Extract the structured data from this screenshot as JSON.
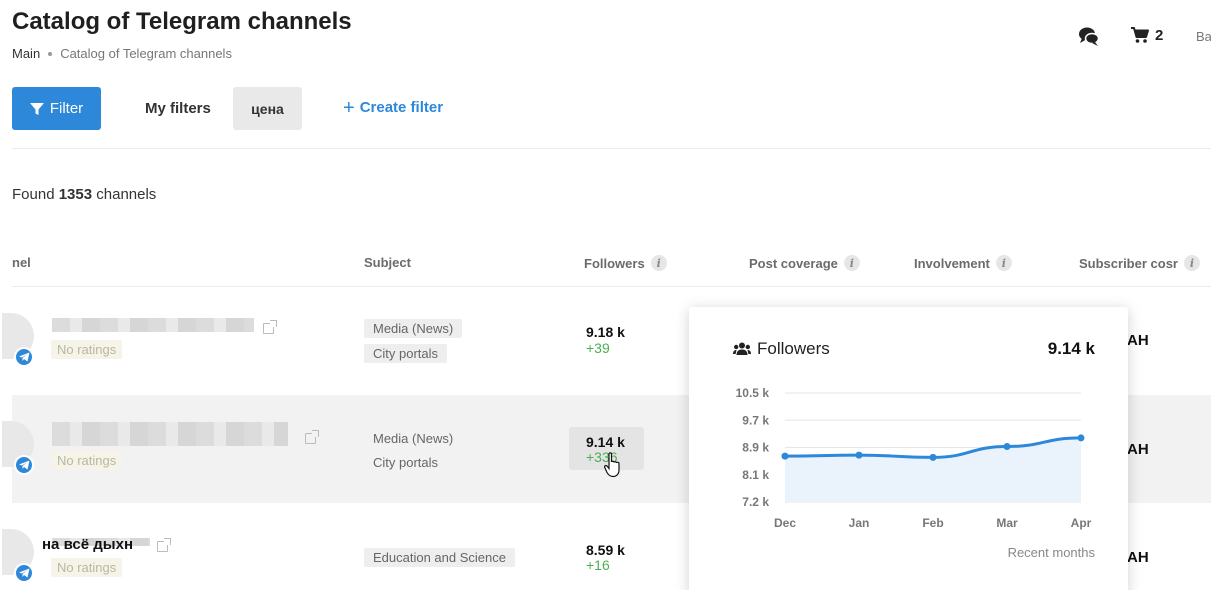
{
  "header": {
    "title": "Catalog of Telegram channels",
    "breadcrumb": {
      "home": "Main",
      "current": "Catalog of Telegram channels"
    },
    "cart_count": "2",
    "lang_partial": "Ba"
  },
  "toolbar": {
    "filter_label": "Filter",
    "my_filters_label": "My filters",
    "saved_filter": "цена",
    "create_filter_label": "Create filter"
  },
  "results": {
    "prefix": "Found",
    "count": "1353",
    "suffix": "channels"
  },
  "columns": [
    {
      "label": "nel"
    },
    {
      "label": "Subject"
    },
    {
      "label": "Followers",
      "info": "i"
    },
    {
      "label": "Post coverage",
      "info": "i"
    },
    {
      "label": "Involvement",
      "info": "i"
    },
    {
      "label": "Subscriber cosr",
      "info": "i"
    }
  ],
  "rows": [
    {
      "rating": "No ratings",
      "subjects": [
        "Media (News)",
        "City portals"
      ],
      "followers": "9.18 k",
      "delta": "+39",
      "right": "AH"
    },
    {
      "rating": "No ratings",
      "subjects": [
        "Media (News)",
        "City portals"
      ],
      "followers": "9.14 k",
      "delta": "+336",
      "right": "AH"
    },
    {
      "name_partial": "на всё дыхн",
      "rating": "No ratings",
      "subjects": [
        "Education and Science"
      ],
      "followers": "8.59 k",
      "delta": "+16",
      "right": "AH"
    }
  ],
  "popup": {
    "title": "Followers",
    "value": "9.14 k",
    "footer": "Recent months",
    "icon": "users-icon"
  },
  "chart_data": {
    "type": "area",
    "categories": [
      "Dec",
      "Jan",
      "Feb",
      "Mar",
      "Apr"
    ],
    "series": [
      {
        "values": [
          8.59,
          8.62,
          8.55,
          8.88,
          9.14
        ]
      }
    ],
    "yticks": [
      "10.5 k",
      "9.7 k",
      "8.9 k",
      "8.1 k",
      "7.2 k"
    ],
    "ylim": [
      7.2,
      10.5
    ],
    "line_color": "#2d88d9",
    "fill_color": "#eaf3fc"
  },
  "colors": {
    "accent": "#2d88d9",
    "positive": "#4caf50"
  }
}
